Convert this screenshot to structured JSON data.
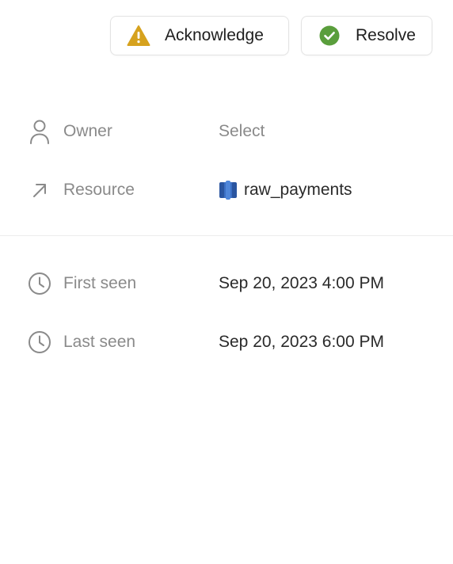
{
  "actions": {
    "acknowledge": {
      "label": "Acknowledge",
      "icon": "warning-icon",
      "color": "#d6a21e"
    },
    "resolve": {
      "label": "Resolve",
      "icon": "check-circle-icon",
      "color": "#5a9e3c"
    }
  },
  "details": {
    "owner": {
      "label": "Owner",
      "value": "Select",
      "icon": "person-icon"
    },
    "resource": {
      "label": "Resource",
      "value": "raw_payments",
      "icon": "arrow-up-right-icon",
      "value_icon": "database-table-icon",
      "value_icon_color": "#3b6fc4"
    }
  },
  "timestamps": {
    "first_seen": {
      "label": "First seen",
      "value": "Sep 20, 2023 4:00 PM",
      "icon": "clock-icon"
    },
    "last_seen": {
      "label": "Last seen",
      "value": "Sep 20, 2023 6:00 PM",
      "icon": "clock-icon"
    }
  }
}
